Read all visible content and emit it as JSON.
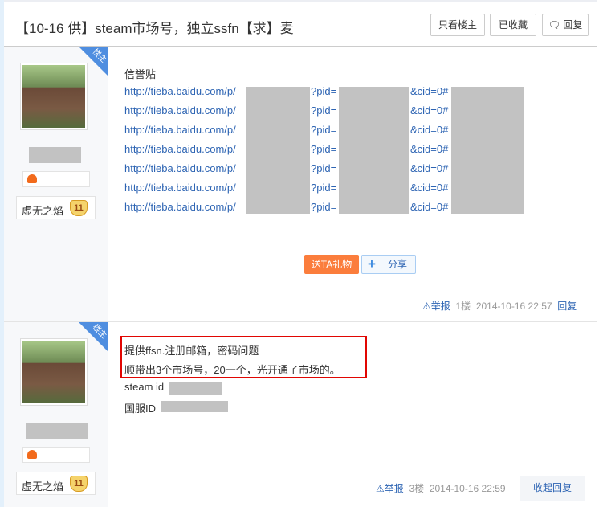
{
  "thread": {
    "title": "【10-16 供】steam市场号，独立ssfn【求】麦",
    "buttons": {
      "only_op": "只看楼主",
      "favorited": "已收藏",
      "reply": "回复"
    }
  },
  "posts": [
    {
      "corner_badge": "楼主",
      "user_title": "虚无之焰",
      "level": "11",
      "lines": [
        "信誉贴"
      ],
      "links": [
        {
          "a": "http://tieba.baidu.com/p/",
          "b": "?pid=",
          "c": "&cid=0#"
        },
        {
          "a": "http://tieba.baidu.com/p/",
          "b": "?pid=",
          "c": "&cid=0#"
        },
        {
          "a": "http://tieba.baidu.com/p/",
          "b": "?pid=",
          "c": "&cid=0#"
        },
        {
          "a": "http://tieba.baidu.com/p/",
          "b": "?pid=",
          "c": "&cid=0#"
        },
        {
          "a": "http://tieba.baidu.com/p/",
          "b": "?pid=",
          "c": "&cid=0#"
        },
        {
          "a": "http://tieba.baidu.com/p/",
          "b": "?pid=",
          "c": "&cid=0#"
        },
        {
          "a": "http://tieba.baidu.com/p/",
          "b": "?pid=",
          "c": "&cid=0#"
        }
      ],
      "gift_button": "送TA礼物",
      "share_button": "分享",
      "report": "举报",
      "floor": "1楼",
      "time": "2014-10-16 22:57",
      "reply": "回复"
    },
    {
      "corner_badge": "楼主",
      "user_title": "虚无之焰",
      "level": "11",
      "lines": [
        "提供ffsn.注册邮箱，密码问题",
        "顺带出3个市场号，20一个，光开通了市场的。",
        "steam id",
        "国服ID"
      ],
      "report": "举报",
      "floor": "3楼",
      "time": "2014-10-16 22:59",
      "collapse": "收起回复"
    }
  ],
  "colors": {
    "accent": "#2d64b3",
    "gift": "#fb7d3c",
    "highlight": "#e10602"
  }
}
